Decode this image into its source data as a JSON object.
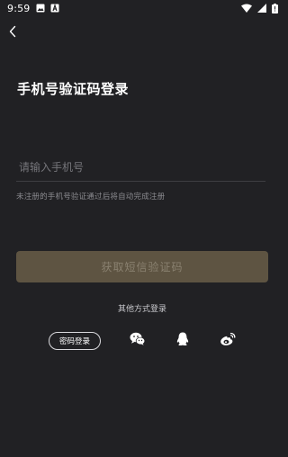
{
  "status_bar": {
    "time": "9:59",
    "icons": [
      "image-icon",
      "a-box-icon",
      "wifi-icon",
      "signal-icon",
      "battery-icon"
    ]
  },
  "nav": {
    "back_icon": "chevron-left-icon"
  },
  "page": {
    "title": "手机号验证码登录"
  },
  "phone_input": {
    "placeholder": "请输入手机号",
    "value": ""
  },
  "hint": "未注册的手机号验证通过后将自动完成注册",
  "sms_button": {
    "label": "获取短信验证码",
    "color": "#5e5442"
  },
  "other_methods": {
    "label": "其他方式登录",
    "password_login_label": "密码登录",
    "social": [
      "wechat-icon",
      "qq-icon",
      "weibo-icon"
    ]
  },
  "colors": {
    "background": "#212124",
    "accent_disabled": "#5e5442"
  }
}
